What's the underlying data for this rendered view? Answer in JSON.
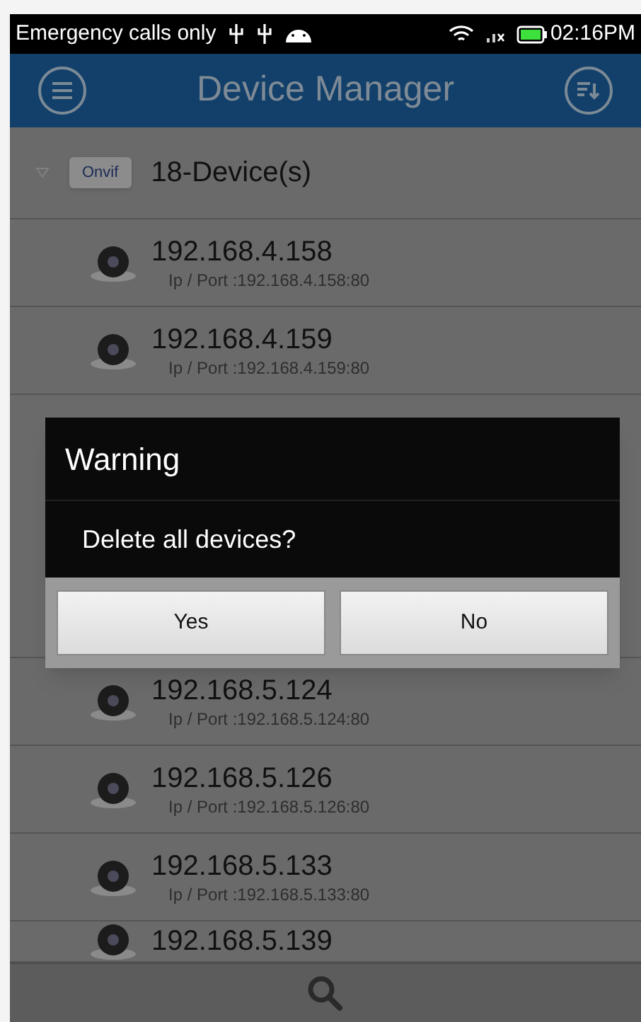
{
  "status_bar": {
    "carrier": "Emergency calls only",
    "time": "02:16PM"
  },
  "header": {
    "title": "Device Manager"
  },
  "group": {
    "badge": "Onvif",
    "label": "18-Device(s)",
    "expanded": true
  },
  "devices_before_dialog": [
    {
      "ip": "192.168.4.158",
      "port": "Ip / Port :192.168.4.158:80"
    },
    {
      "ip": "192.168.4.159",
      "port": "Ip / Port :192.168.4.159:80"
    }
  ],
  "devices_after_dialog": [
    {
      "ip": "192.168.5.124",
      "port": "Ip / Port :192.168.5.124:80"
    },
    {
      "ip": "192.168.5.126",
      "port": "Ip / Port :192.168.5.126:80"
    },
    {
      "ip": "192.168.5.133",
      "port": "Ip / Port :192.168.5.133:80"
    },
    {
      "ip": "192.168.5.139"
    }
  ],
  "dialog": {
    "title": "Warning",
    "message": "Delete all devices?",
    "buttons": [
      "Yes",
      "No"
    ]
  }
}
